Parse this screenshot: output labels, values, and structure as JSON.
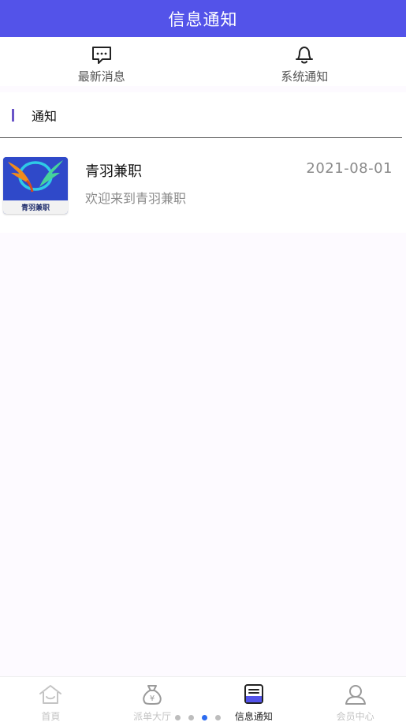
{
  "header": {
    "title": "信息通知",
    "bg_color": "#5353e9"
  },
  "tabs": [
    {
      "label": "最新消息",
      "icon": "chat-bubble-icon"
    },
    {
      "label": "系统通知",
      "icon": "bell-icon"
    }
  ],
  "section": {
    "title": "通知",
    "accent_color": "#6a55c8",
    "messages": [
      {
        "name": "青羽兼职",
        "date": "2021-08-01",
        "text": "欢迎来到青羽兼职",
        "avatar_text": "青羽兼职"
      }
    ]
  },
  "bottom_nav": [
    {
      "label": "首頁",
      "icon": "home-icon",
      "active": false
    },
    {
      "label": "派单大厅",
      "icon": "money-bag-icon",
      "active": false
    },
    {
      "label": "信息通知",
      "icon": "message-list-icon",
      "active": true
    },
    {
      "label": "会员中心",
      "icon": "user-icon",
      "active": false
    }
  ],
  "pager": {
    "count": 4,
    "active_index": 2,
    "active_color": "#2d6cf0"
  }
}
